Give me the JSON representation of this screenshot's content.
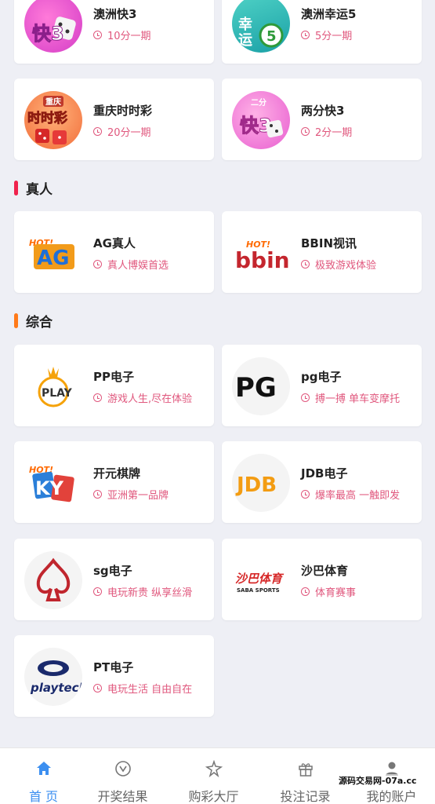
{
  "sections": {
    "live": {
      "title": "真人",
      "accent": "#f0224c"
    },
    "general": {
      "title": "综合",
      "accent": "#ff7a1a"
    }
  },
  "lottery": [
    {
      "name": "澳洲快3",
      "period": "10分一期",
      "icon": "dice-kuai3-icon"
    },
    {
      "name": "澳洲幸运5",
      "period": "5分一期",
      "icon": "lucky5-ball-icon"
    },
    {
      "name": "重庆时时彩",
      "period": "20分一期",
      "icon": "chongqing-ssc-icon",
      "logo_text": "重庆",
      "logo_text2": "时时彩"
    },
    {
      "name": "两分快3",
      "period": "2分一期",
      "icon": "two-min-kuai3-icon",
      "logo_text": "二分",
      "logo_text2": "快3"
    }
  ],
  "live": [
    {
      "name": "AG真人",
      "desc": "真人博娱首选",
      "icon": "ag-logo-icon",
      "logo_text": "AG"
    },
    {
      "name": "BBIN视讯",
      "desc": "极致游戏体验",
      "icon": "bbin-logo-icon",
      "logo_text": "bbin"
    }
  ],
  "general": [
    {
      "name": "PP电子",
      "desc": "游戏人生,尽在体验",
      "icon": "pp-play-logo-icon",
      "logo_text": "PLAY"
    },
    {
      "name": "pg电子",
      "desc": "搏一搏 单车变摩托",
      "icon": "pg-logo-icon",
      "logo_text": "PG"
    },
    {
      "name": "开元棋牌",
      "desc": "亚洲第一品牌",
      "icon": "ky-logo-icon",
      "logo_text": "KY"
    },
    {
      "name": "JDB电子",
      "desc": "爆率最高 一触即发",
      "icon": "jdb-logo-icon",
      "logo_text": "JDB"
    },
    {
      "name": "sg电子",
      "desc": "电玩新贵 纵享丝滑",
      "icon": "sg-spade-logo-icon"
    },
    {
      "name": "沙巴体育",
      "desc": "体育赛事",
      "icon": "saba-sports-logo-icon",
      "logo_text": "沙巴体育",
      "logo_text2": "SABA SPORTS"
    },
    {
      "name": "PT电子",
      "desc": "电玩生活 自由自在",
      "icon": "playtech-logo-icon",
      "logo_text": "playtech"
    }
  ],
  "tabbar": [
    {
      "label": "首 页",
      "icon": "home-icon",
      "active": true
    },
    {
      "label": "开奖结果",
      "icon": "lottery-result-icon",
      "active": false
    },
    {
      "label": "购彩大厅",
      "icon": "lottery-hall-icon",
      "active": false
    },
    {
      "label": "投注记录",
      "icon": "gift-icon",
      "active": false
    },
    {
      "label": "我的账户",
      "icon": "user-icon",
      "active": false
    }
  ],
  "colors": {
    "accent_blue": "#3c8ff0",
    "desc_pink": "#e0577d"
  },
  "watermark": "源码交易网-07a.cc"
}
